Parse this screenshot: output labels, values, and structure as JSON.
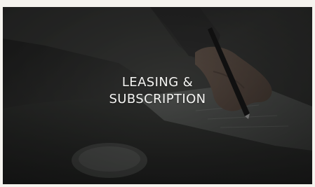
{
  "card": {
    "title": "LEASING &\nSUBSCRIPTION",
    "image_subject": "hand-signing-document-photo"
  },
  "colors": {
    "page_background": "#f5f3ee",
    "text": "#f4f4f2",
    "overlay": "#1b1c1b"
  }
}
